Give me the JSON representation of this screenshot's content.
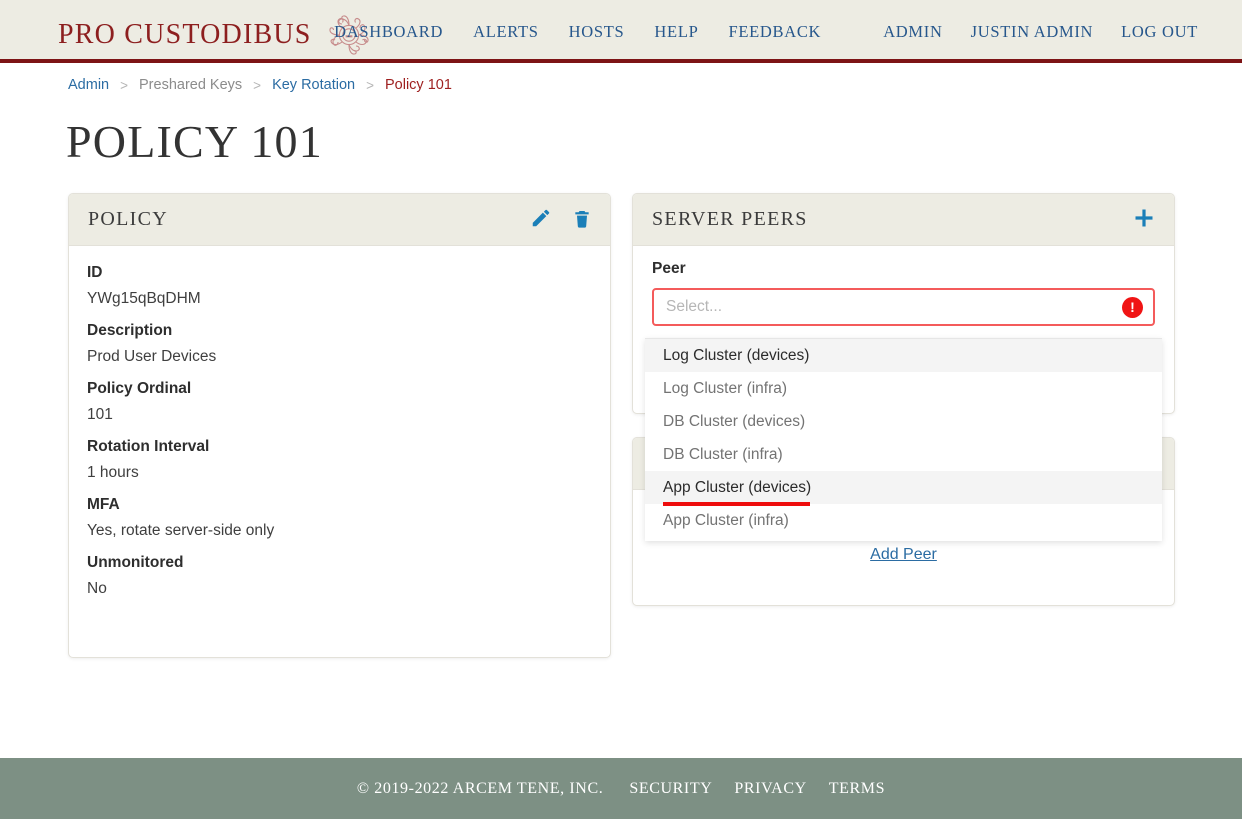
{
  "header": {
    "brand_name": "PRO CUSTODIBUS",
    "brand_mark_icon": "medusa-head-logo",
    "nav_primary": [
      {
        "label": "DASHBOARD"
      },
      {
        "label": "ALERTS"
      },
      {
        "label": "HOSTS"
      },
      {
        "label": "HELP"
      },
      {
        "label": "FEEDBACK"
      }
    ],
    "nav_secondary": [
      {
        "label": "ADMIN"
      },
      {
        "label": "JUSTIN ADMIN"
      },
      {
        "label": "LOG OUT"
      }
    ]
  },
  "breadcrumb": {
    "separator": ">",
    "items": [
      {
        "label": "Admin",
        "state": "link"
      },
      {
        "label": "Preshared Keys",
        "state": "muted"
      },
      {
        "label": "Key Rotation",
        "state": "link"
      },
      {
        "label": "Policy 101",
        "state": "current"
      }
    ]
  },
  "page": {
    "title": "POLICY 101"
  },
  "policy_card": {
    "title": "POLICY",
    "edit_icon": "pencil-icon",
    "delete_icon": "trash-icon",
    "fields": [
      {
        "label": "ID",
        "value": "YWg15qBqDHM"
      },
      {
        "label": "Description",
        "value": "Prod User Devices"
      },
      {
        "label": "Policy Ordinal",
        "value": "101"
      },
      {
        "label": "Rotation Interval",
        "value": "1 hours"
      },
      {
        "label": "MFA",
        "value": "Yes, rotate server-side only"
      },
      {
        "label": "Unmonitored",
        "value": "No"
      }
    ]
  },
  "peers_card": {
    "title": "SERVER PEERS",
    "add_icon": "plus-icon",
    "peer_label": "Peer",
    "select_placeholder": "Select...",
    "error_icon": "exclamation-icon",
    "error_symbol": "!",
    "add_peer_label": "Add Peer",
    "options": [
      {
        "label": "Log Cluster (devices)",
        "focused": true,
        "marked": false
      },
      {
        "label": "Log Cluster (infra)",
        "focused": false,
        "marked": false
      },
      {
        "label": "DB Cluster (devices)",
        "focused": false,
        "marked": false
      },
      {
        "label": "DB Cluster (infra)",
        "focused": false,
        "marked": false
      },
      {
        "label": "App Cluster (devices)",
        "focused": true,
        "marked": true
      },
      {
        "label": "App Cluster (infra)",
        "focused": false,
        "marked": false
      }
    ]
  },
  "footer": {
    "copyright": "© 2019-2022 ARCEM TENE, INC.",
    "links": [
      {
        "label": "SECURITY"
      },
      {
        "label": "PRIVACY"
      },
      {
        "label": "TERMS"
      }
    ]
  },
  "colors": {
    "header_bg": "#edece3",
    "header_rule": "#7d1416",
    "brand": "#8d1f1f",
    "nav_link": "#27578c",
    "link": "#2b6ca3",
    "current_crumb": "#9e1f1f",
    "icon_blue": "#1b7fb8",
    "error_red": "#f01414",
    "error_border": "#f45b5b",
    "marker_red": "#ee0d0d",
    "footer_bg": "#7d9084"
  }
}
